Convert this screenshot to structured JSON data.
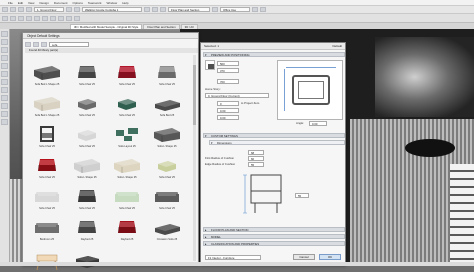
{
  "menubar": {
    "items": [
      "File",
      "Edit",
      "View",
      "Design",
      "Document",
      "Options",
      "Teamwork",
      "Window",
      "Help"
    ]
  },
  "toolbar": {
    "project_field": "1. Ground Floor",
    "view_field": "Walking Couple Cordoba 1",
    "floorplan_tab": "Floor Plan and Section",
    "layer_field": "Office Use"
  },
  "tabs": [
    {
      "label": "3D / Modified with Model Sample - Original 3D Style"
    },
    {
      "label": "Floor Plan and Section"
    },
    {
      "label": "3D / All"
    }
  ],
  "object_library": {
    "title": "Object Default Settings",
    "search_value": "sofa",
    "folder_label": "Found 40 library part(s)",
    "items": [
      {
        "label": "Sofa Bed L Shape 25",
        "color": "#4e4e4e",
        "shape": "lsofa"
      },
      {
        "label": "Sofa Chair 25",
        "color": "#5a5a5a",
        "shape": "chair"
      },
      {
        "label": "Sofa Chair 25",
        "color": "#b3152a",
        "shape": "chair"
      },
      {
        "label": "Sofa Chair 25",
        "color": "#8d8d8d",
        "shape": "chair"
      },
      {
        "label": "Sofa Bed L Shape 25",
        "color": "#d9d2c2",
        "shape": "lsofa"
      },
      {
        "label": "Sofa Chair 25",
        "color": "#6a6a6a",
        "shape": "small"
      },
      {
        "label": "Sofa Chair 25",
        "color": "#2f5f4f",
        "shape": "small"
      },
      {
        "label": "Sofa Bed 25",
        "color": "#4a4a4a",
        "shape": "bed"
      },
      {
        "label": "Sofa Chair 25",
        "color": "#3a3a3a",
        "shape": "frame"
      },
      {
        "label": "Sofa Chair 25",
        "color": "#d6d6d6",
        "shape": "small"
      },
      {
        "label": "Sofa Layout 25",
        "color": "#3f6f5f",
        "shape": "set"
      },
      {
        "label": "Sofa L Shape 25",
        "color": "#575757",
        "shape": "lsofa"
      },
      {
        "label": "Sofa Chair 25",
        "color": "#b5121b",
        "shape": "chair"
      },
      {
        "label": "Sofa L Shape 25",
        "color": "#cfcfcf",
        "shape": "lsofa"
      },
      {
        "label": "Sofa L Shape 25",
        "color": "#ddd5c0",
        "shape": "lsofa"
      },
      {
        "label": "Sofa Chair 25",
        "color": "#c9cf9c",
        "shape": "small"
      },
      {
        "label": "Sofa Chair 25",
        "color": "#d8d8d8",
        "shape": "sofa2"
      },
      {
        "label": "Sofa Chair 25",
        "color": "#4a4a4a",
        "shape": "chair"
      },
      {
        "label": "Sofa Chair 25",
        "color": "#c6dbc0",
        "shape": "sofa2"
      },
      {
        "label": "Sofa Chair 25",
        "color": "#5c5c5c",
        "shape": "sofa2"
      },
      {
        "label": "Bedroom 25",
        "color": "#6e6e6e",
        "shape": "sofa2"
      },
      {
        "label": "Daybed 25",
        "color": "#5a5a5a",
        "shape": "chair"
      },
      {
        "label": "Daybed 25",
        "color": "#a3101e",
        "shape": "chair"
      },
      {
        "label": "Occasion Sofa 25",
        "color": "#4a4a4a",
        "shape": "bed"
      },
      {
        "label": "",
        "color": "#f1d9b8",
        "shape": "stool"
      },
      {
        "label": "",
        "color": "#3a3a3a",
        "shape": "box"
      }
    ]
  },
  "settings": {
    "title": "Selected: 1",
    "default_label": "Default",
    "sections": {
      "preview": "PREVIEW AND POSITIONING",
      "custom": "CUSTOM SETTINGS",
      "dimensions": "Dimensions",
      "floorplan": "FLOOR PLAN AND SECTION",
      "model": "MODEL",
      "classification": "CLASSIFICATION AND PROPERTIES"
    },
    "fields": {
      "width": "500",
      "depth": "370",
      "height": "700",
      "home_story": "0. Ground Floor (Current)",
      "to_project_zero": "0",
      "elevation": "0.00",
      "angle": "0.00",
      "dim_a": "68",
      "dim_b": "60",
      "dim_c": "55"
    },
    "labels": {
      "home_story": "Home Story:",
      "to_project_zero": "to Project Zero",
      "angle": "Angle:",
      "first_radius": "First Radius of Cushion",
      "edge_radius": "Edge Radius of Cushion"
    },
    "layer": "F1 Interior - Furniture",
    "cancel_label": "Cancel",
    "ok_label": "OK"
  }
}
